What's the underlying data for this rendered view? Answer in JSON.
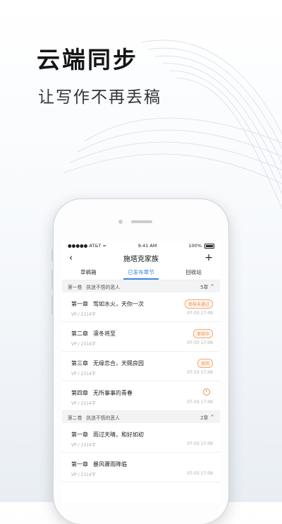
{
  "headline": "云端同步",
  "subline": "让写作不再丢稿",
  "status_bar": {
    "carrier": "●●●●● AT&T",
    "time": "9:41 AM",
    "battery": "100%"
  },
  "nav": {
    "back_icon": "‹",
    "title": "施塔克家族",
    "add_icon": "+"
  },
  "tabs": [
    {
      "label": "草稿箱",
      "active": false
    },
    {
      "label": "已发布章节",
      "active": true
    },
    {
      "label": "回收站",
      "active": false
    }
  ],
  "volumes": [
    {
      "name": "第一卷",
      "subtitle": "执迷不悟的恶人",
      "count": "5章",
      "expand_icon": "^",
      "chapters": [
        {
          "num": "第一章",
          "title": "驾如水火，天你一次",
          "meta": "VP / 2314字",
          "date": "07-03 17:09",
          "status": "审核未通过"
        },
        {
          "num": "第二章",
          "title": "凛冬将至",
          "meta": "VP / 2314字",
          "date": "07-03 17:09",
          "status": "审核中"
        },
        {
          "num": "第三章",
          "title": "无缘恋合，天赐良园",
          "meta": "VP / 2314字",
          "date": "07-03 17:09",
          "status": "驳回"
        },
        {
          "num": "第四章",
          "title": "无所事事的青春",
          "meta": "VP / 2314字",
          "date": "07-03 17:09",
          "status": "timer-icon"
        }
      ]
    },
    {
      "name": "第二卷",
      "subtitle": "执迷不悟的恶人",
      "count": "2章",
      "expand_icon": "^",
      "chapters": [
        {
          "num": "第一章",
          "title": "雨过天晴，和好如初",
          "meta": "VP / 2314字",
          "date": "07-03 17:09"
        },
        {
          "num": "第一章",
          "title": "暴风骤雨降临",
          "meta": "VP / 2314字",
          "date": "07-03 17:09"
        }
      ]
    }
  ],
  "colors": {
    "accent": "#3a86e8",
    "badge": "#f08a45",
    "section_bg": "#f2f3f5"
  }
}
